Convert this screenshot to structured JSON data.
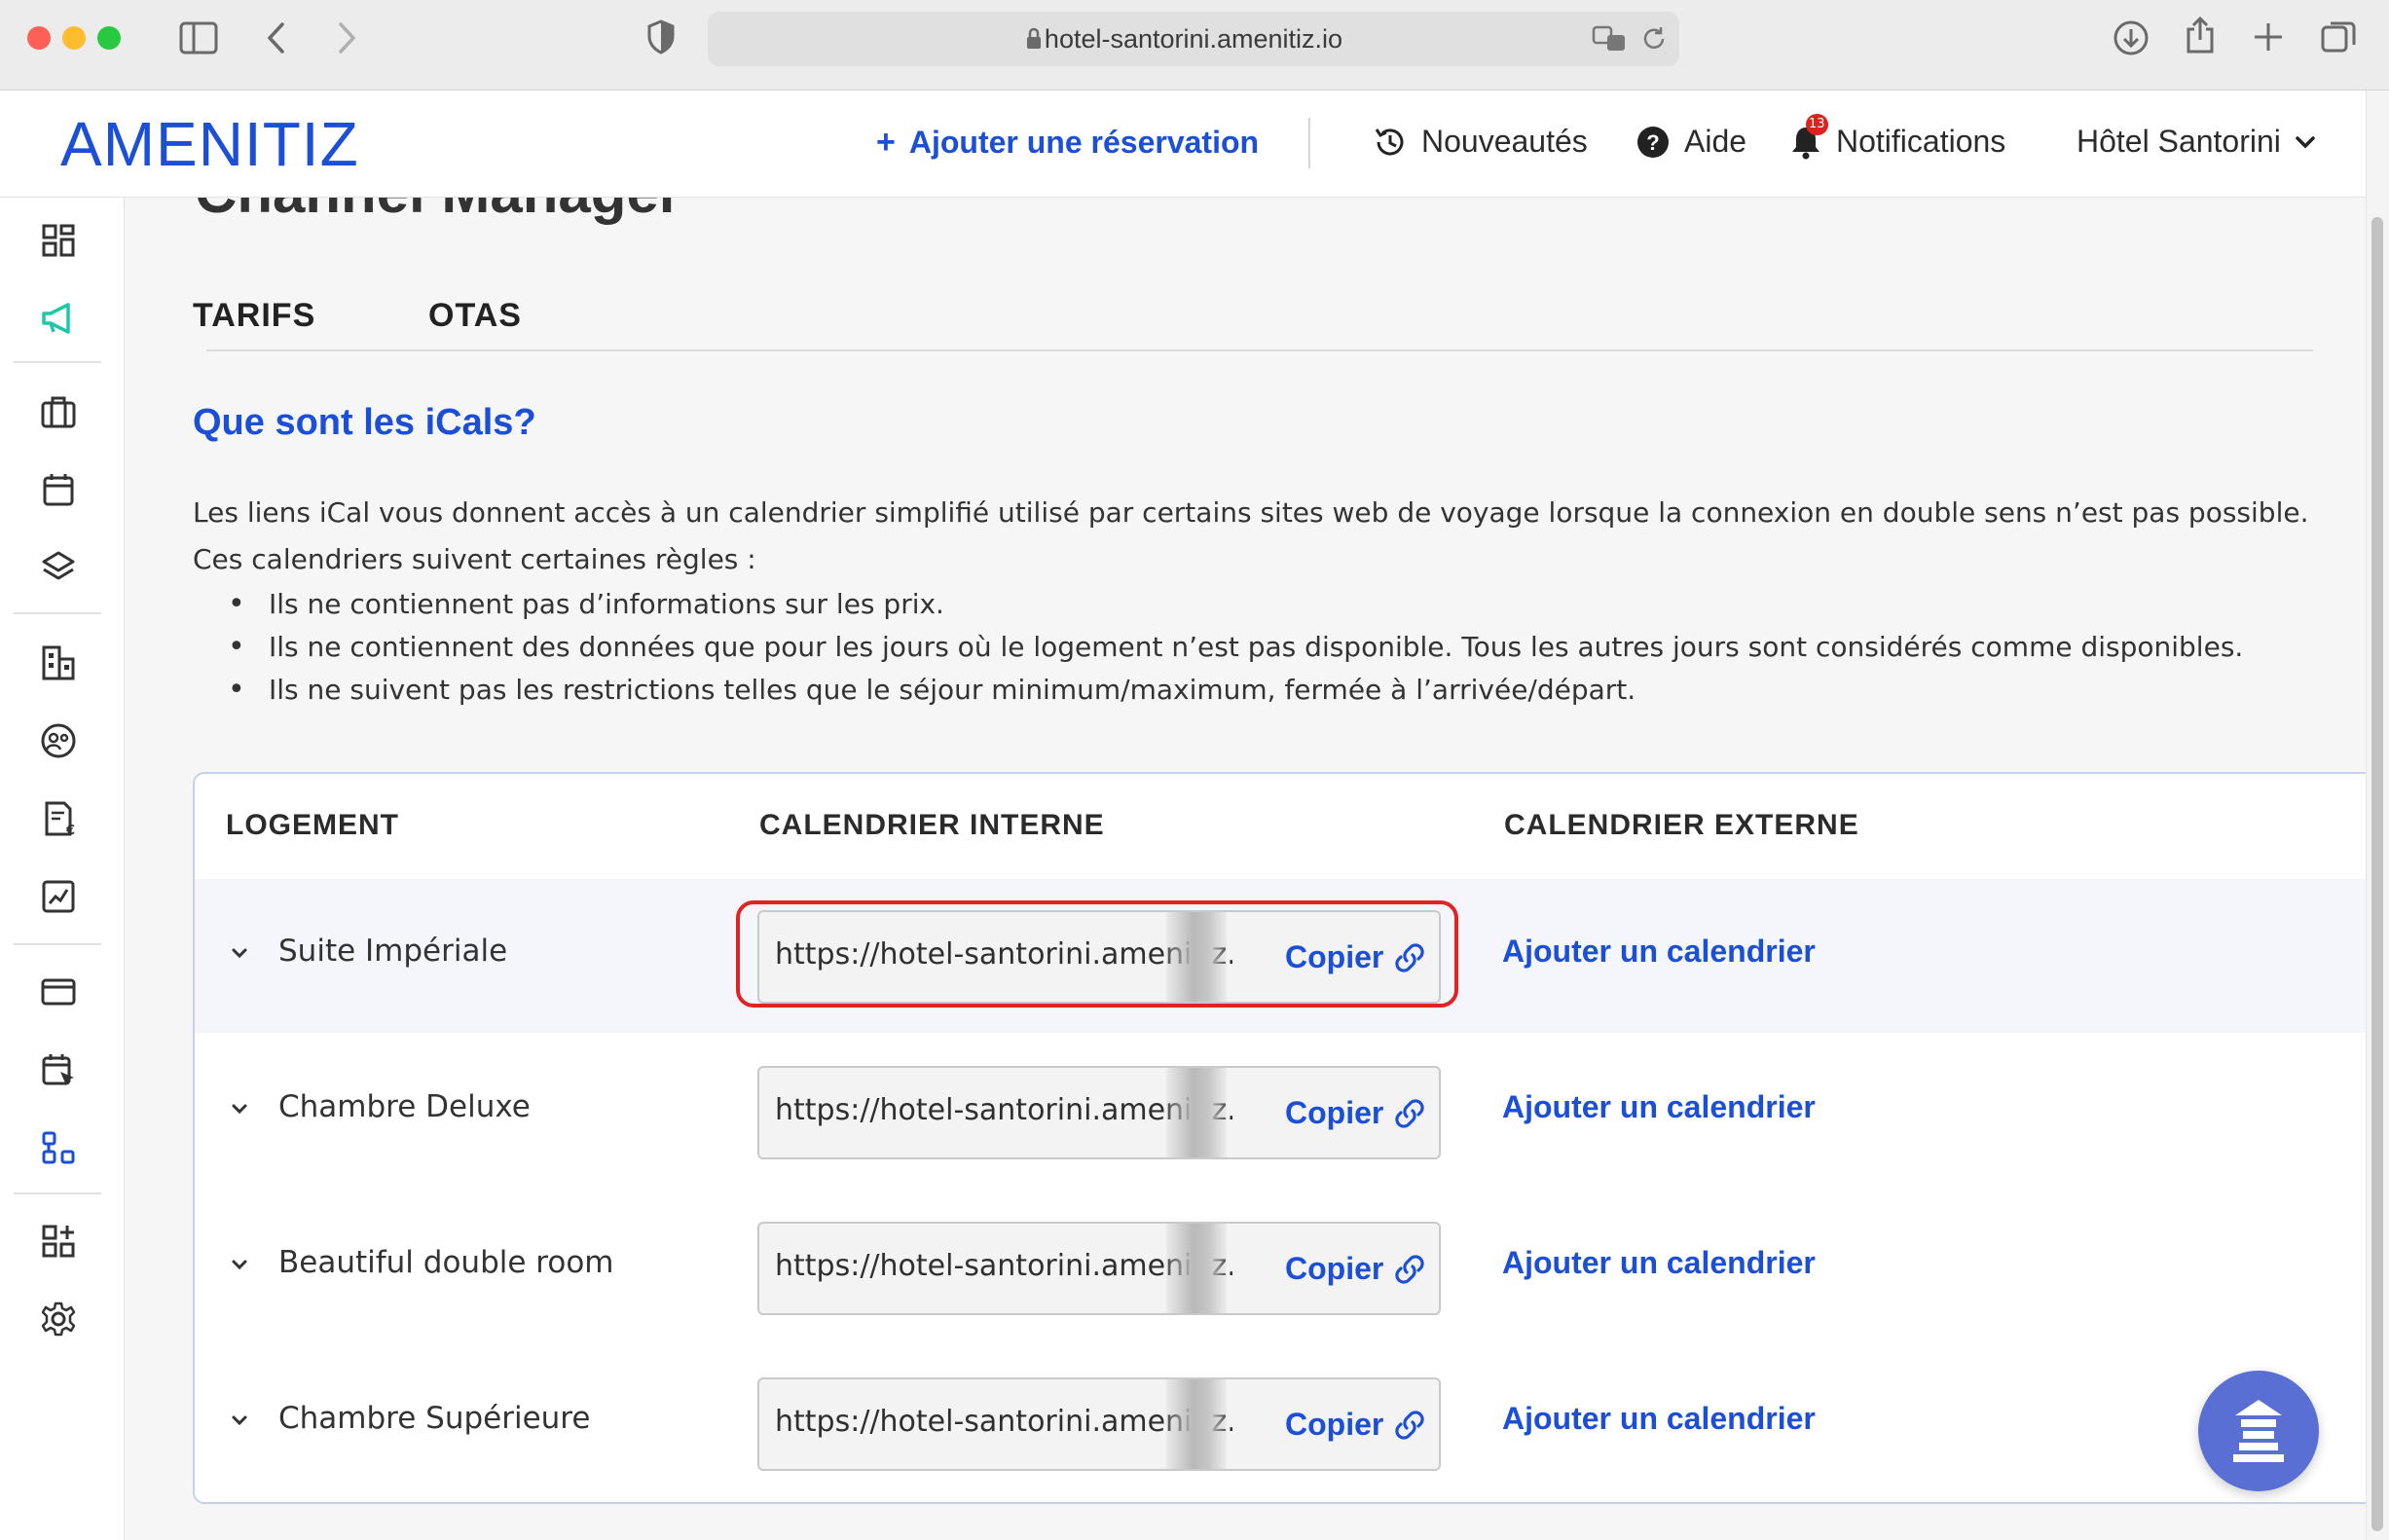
{
  "browser": {
    "url": "hotel-santorini.amenitiz.io"
  },
  "header": {
    "logo": "AMENITIZ",
    "add_reservation": "Ajouter une réservation",
    "whats_new": "Nouveautés",
    "help": "Aide",
    "notifications": "Notifications",
    "notifications_count": "13",
    "hotel": "Hôtel Santorini"
  },
  "page": {
    "title": "Channel Manager",
    "tabs": [
      "TARIFS",
      "OTAS"
    ],
    "section_title": "Que sont les iCals?",
    "intro_1": "Les liens iCal vous donnent accès à un calendrier simplifié utilisé par certains sites web de voyage lorsque la connexion en double sens n’est pas possible.",
    "intro_2": "Ces calendriers suivent certaines règles :",
    "rules": [
      "Ils ne contiennent pas d’informations sur les prix.",
      "Ils ne contiennent des données que pour les jours où le logement n’est pas disponible. Tous les autres jours sont considérés comme disponibles.",
      "Ils ne suivent pas les restrictions telles que le séjour minimum/maximum, fermée à l’arrivée/départ."
    ]
  },
  "table": {
    "headers": [
      "LOGEMENT",
      "CALENDRIER INTERNE",
      "CALENDRIER EXTERNE"
    ],
    "copy_label": "Copier",
    "add_calendar_label": "Ajouter un calendrier",
    "rows": [
      {
        "room": "Suite Impériale",
        "url": "https://hotel-santorini.amenitiz."
      },
      {
        "room": "Chambre Deluxe",
        "url": "https://hotel-santorini.amenitiz."
      },
      {
        "room": "Beautiful double room",
        "url": "https://hotel-santorini.amenitiz."
      },
      {
        "room": "Chambre Supérieure",
        "url": "https://hotel-santorini.amenitiz."
      }
    ]
  },
  "colors": {
    "accent": "#1b4fd8",
    "highlight_ring": "#e12323",
    "megaphone_active": "#1fc9a8"
  },
  "icons": {
    "sidebar": [
      "dashboard-icon",
      "megaphone-icon",
      "briefcase-icon",
      "calendar-icon",
      "layers-icon",
      "building-icon",
      "guests-icon",
      "invoice-icon",
      "chart-icon",
      "payment-card-icon",
      "calendar-pointer-icon",
      "channel-manager-icon",
      "add-apps-icon",
      "gear-icon"
    ]
  }
}
